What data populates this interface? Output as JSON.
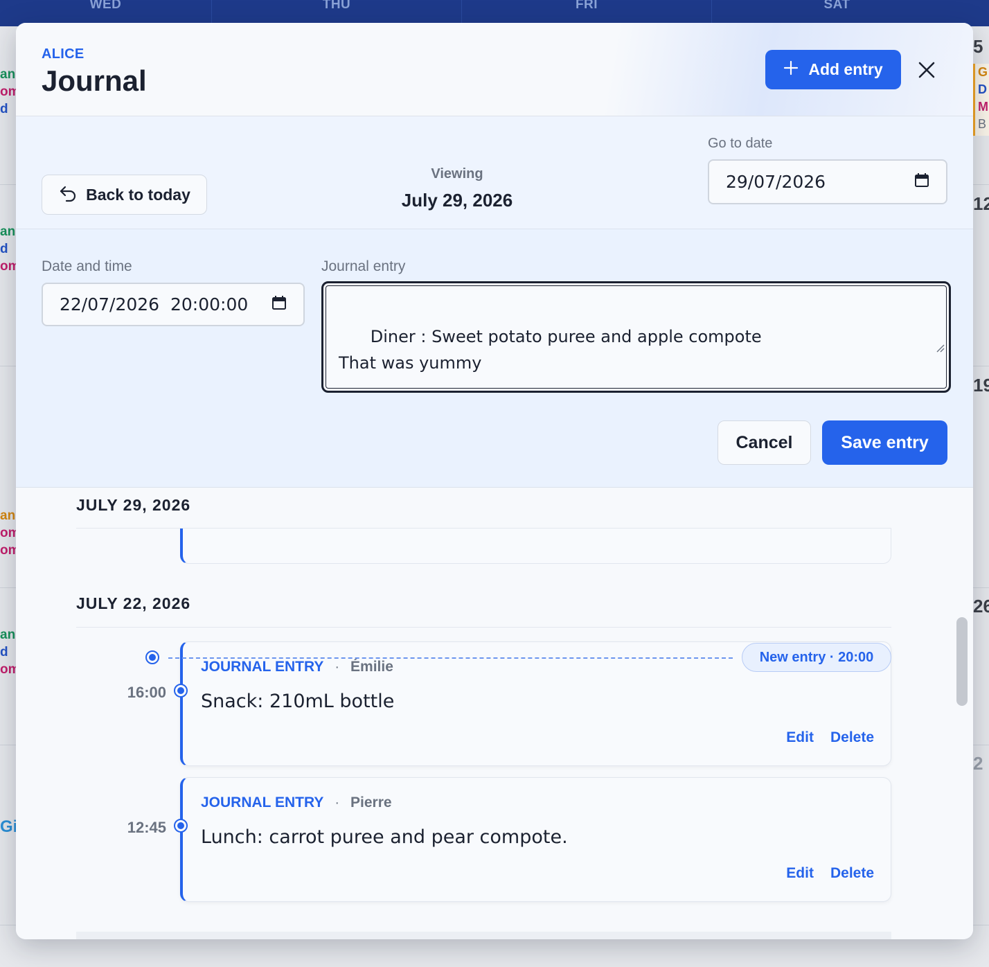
{
  "calendar": {
    "days": [
      "WED",
      "THU",
      "FRI",
      "SAT"
    ],
    "left_peeks": [
      "anr",
      "om",
      "d",
      "anr",
      "d",
      "om",
      "an",
      "om",
      "om",
      "anr",
      "d",
      "om",
      "Gi"
    ],
    "right_peeks": [
      "5",
      "12",
      "19",
      "26",
      "2"
    ],
    "right_card_lines": [
      "G",
      "D",
      "M",
      "B"
    ]
  },
  "modal": {
    "eyebrow": "ALICE",
    "title": "Journal",
    "add_entry_label": "Add entry",
    "nav": {
      "back_label": "Back to today",
      "viewing_label": "Viewing",
      "viewing_date": "July 29, 2026",
      "goto_label": "Go to date",
      "goto_value": "29/07/2026"
    },
    "form": {
      "datetime_label": "Date and time",
      "datetime_value": "22/07/2026  20:00:00",
      "entry_label": "Journal entry",
      "entry_value": "Diner : Sweet potato puree and apple compote\nThat was yummy",
      "cancel_label": "Cancel",
      "save_label": "Save entry"
    },
    "timeline": {
      "days": [
        {
          "heading": "JULY 29, 2026"
        },
        {
          "heading": "JULY 22, 2026"
        }
      ],
      "new_entry_marker": "New entry · 20:00",
      "entries": [
        {
          "time": "16:00",
          "kind": "JOURNAL ENTRY",
          "sep": "·",
          "author": "Émilie",
          "text": "Snack: 210mL bottle",
          "edit": "Edit",
          "delete": "Delete"
        },
        {
          "time": "12:45",
          "kind": "JOURNAL ENTRY",
          "sep": "·",
          "author": "Pierre",
          "text": "Lunch: carrot puree and pear compote.",
          "edit": "Edit",
          "delete": "Delete"
        }
      ]
    }
  },
  "colors": {
    "accent": "#2563eb",
    "header_bg": "#1e3a8a",
    "text": "#1b2130",
    "muted": "#6a7280"
  },
  "icons": [
    "plus-icon",
    "close-icon",
    "undo-arrow-icon",
    "calendar-icon",
    "resize-grip-icon"
  ]
}
